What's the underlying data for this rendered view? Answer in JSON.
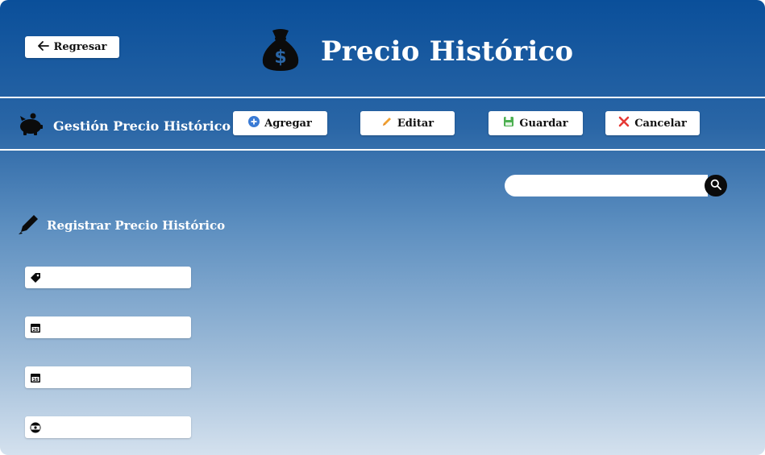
{
  "header": {
    "back_label": "Regresar",
    "title": "Precio Histórico",
    "title_icon": "money-bag-icon"
  },
  "toolbar": {
    "title": "Gestión Precio Histórico",
    "title_icon": "piggy-bank-icon",
    "buttons": {
      "add": "Agregar",
      "edit": "Editar",
      "save": "Guardar",
      "cancel": "Cancelar"
    }
  },
  "search": {
    "value": "",
    "placeholder": ""
  },
  "form": {
    "title": "Registrar Precio Histórico",
    "title_icon": "pencil-icon",
    "fields": [
      {
        "icon": "tag-icon",
        "value": "",
        "placeholder": ""
      },
      {
        "icon": "calendar-icon",
        "value": "",
        "placeholder": ""
      },
      {
        "icon": "calendar-icon",
        "value": "",
        "placeholder": ""
      },
      {
        "icon": "money-icon",
        "value": "",
        "placeholder": ""
      }
    ]
  },
  "colors": {
    "background_top": "#0a4f9a",
    "background_bottom": "#d4e1ee",
    "add_icon": "#3a7bd5",
    "edit_icon": "#f0a030",
    "save_icon": "#4caf50",
    "cancel_icon": "#e53935"
  }
}
